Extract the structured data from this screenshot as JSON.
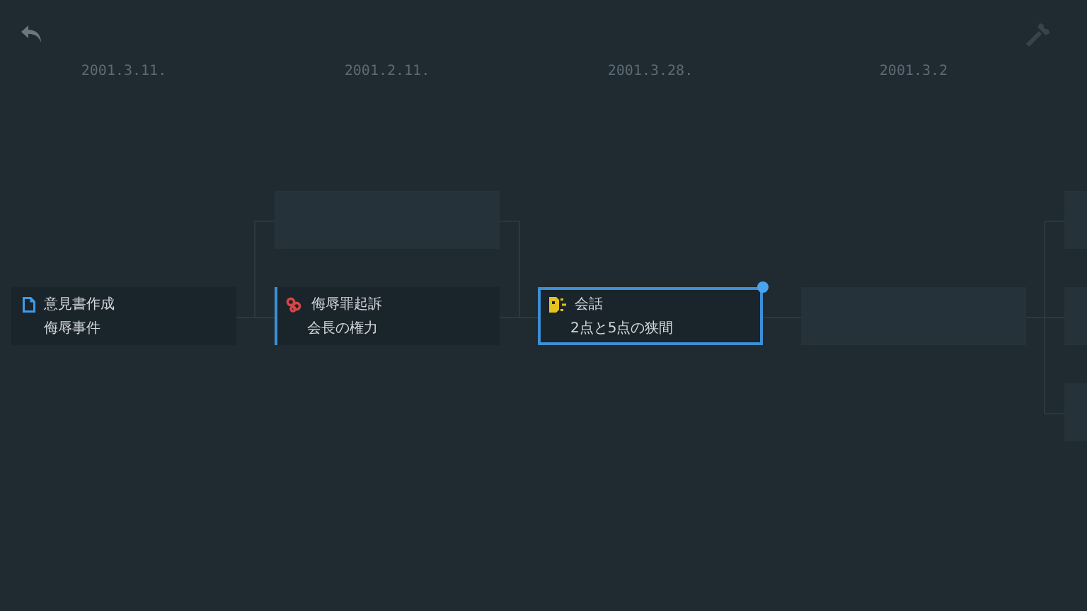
{
  "columns": [
    {
      "date": "2001.3.11.",
      "nodes": [
        {
          "kind": "document",
          "title": "意見書作成",
          "subtitle": "侮辱事件",
          "selected": false,
          "accent": false
        }
      ]
    },
    {
      "date": "2001.2.11.",
      "nodes": [
        {
          "kind": "empty"
        },
        {
          "kind": "rings",
          "title": "侮辱罪起訴",
          "subtitle": "会長の権力",
          "selected": false,
          "accent": true
        }
      ]
    },
    {
      "date": "2001.3.28.",
      "nodes": [
        {
          "kind": "speech",
          "title": "会話",
          "subtitle": "2点と5点の狭間",
          "selected": true
        }
      ]
    },
    {
      "date": "2001.3.2",
      "nodes": [
        {
          "kind": "empty"
        }
      ]
    },
    {
      "nodes": [
        {
          "kind": "empty"
        },
        {
          "kind": "empty"
        },
        {
          "kind": "empty"
        }
      ]
    }
  ]
}
